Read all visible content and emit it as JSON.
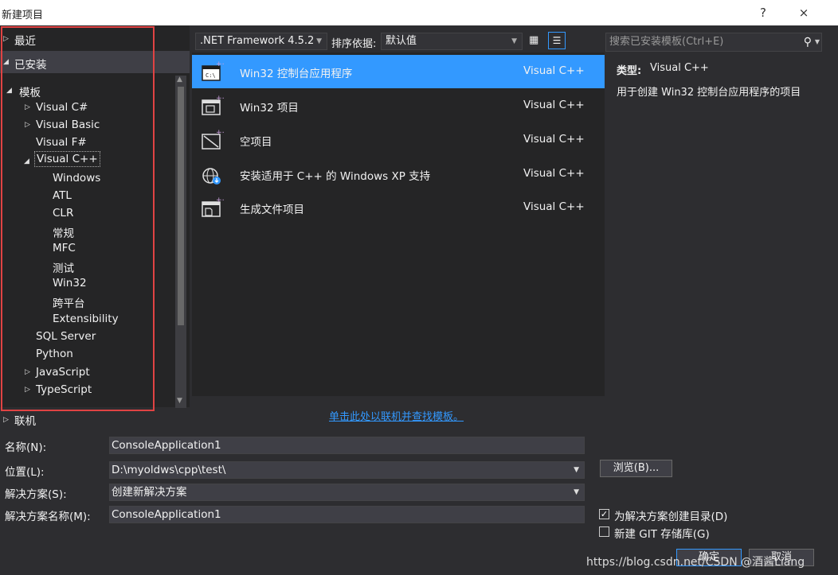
{
  "window": {
    "title": "新建项目",
    "help": "?",
    "close": "×"
  },
  "tree": {
    "recent": "最近",
    "installed": "已安装",
    "templates": "模板",
    "csharp": "Visual C#",
    "vb": "Visual Basic",
    "fsharp": "Visual F#",
    "cpp": "Visual C++",
    "cpp_children": [
      "Windows",
      "ATL",
      "CLR",
      "常规",
      "MFC",
      "测试",
      "Win32",
      "跨平台",
      "Extensibility"
    ],
    "sql": "SQL Server",
    "python": "Python",
    "js": "JavaScript",
    "ts": "TypeScript",
    "online": "联机"
  },
  "toolbar": {
    "framework": ".NET Framework 4.5.2",
    "sort_label": "排序依据:",
    "sort_value": "默认值"
  },
  "search": {
    "placeholder": "搜索已安装模板(Ctrl+E)"
  },
  "templates": [
    {
      "name": "Win32 控制台应用程序",
      "lang": "Visual C++",
      "icon": "console-app-icon",
      "selected": true
    },
    {
      "name": "Win32 项目",
      "lang": "Visual C++",
      "icon": "win32-project-icon",
      "selected": false
    },
    {
      "name": "空项目",
      "lang": "Visual C++",
      "icon": "empty-project-icon",
      "selected": false
    },
    {
      "name": "安装适用于 C++ 的 Windows XP 支持",
      "lang": "Visual C++",
      "icon": "globe-download-icon",
      "selected": false
    },
    {
      "name": "生成文件项目",
      "lang": "Visual C++",
      "icon": "makefile-project-icon",
      "selected": false
    }
  ],
  "details": {
    "type_label": "类型:",
    "type_value": "Visual C++",
    "description": "用于创建 Win32 控制台应用程序的项目"
  },
  "online_link": "单击此处以联机并查找模板。",
  "form": {
    "name_label": "名称(N):",
    "name_value": "ConsoleApplication1",
    "location_label": "位置(L):",
    "location_value": "D:\\myoldws\\cpp\\test\\",
    "solution_label": "解决方案(S):",
    "solution_value": "创建新解决方案",
    "solution_name_label": "解决方案名称(M):",
    "solution_name_value": "ConsoleApplication1",
    "browse": "浏览(B)...",
    "create_dir": "为解决方案创建目录(D)",
    "create_dir_checked": true,
    "git": "新建 GIT 存储库(G)",
    "git_checked": false,
    "ok": "确定",
    "cancel": "取消"
  },
  "watermark": "https://blog.csdn.net/CSDN @酒酱Liang",
  "colors": {
    "selection": "#3399ff",
    "highlight_border": "#e04343",
    "link": "#3399ff"
  }
}
